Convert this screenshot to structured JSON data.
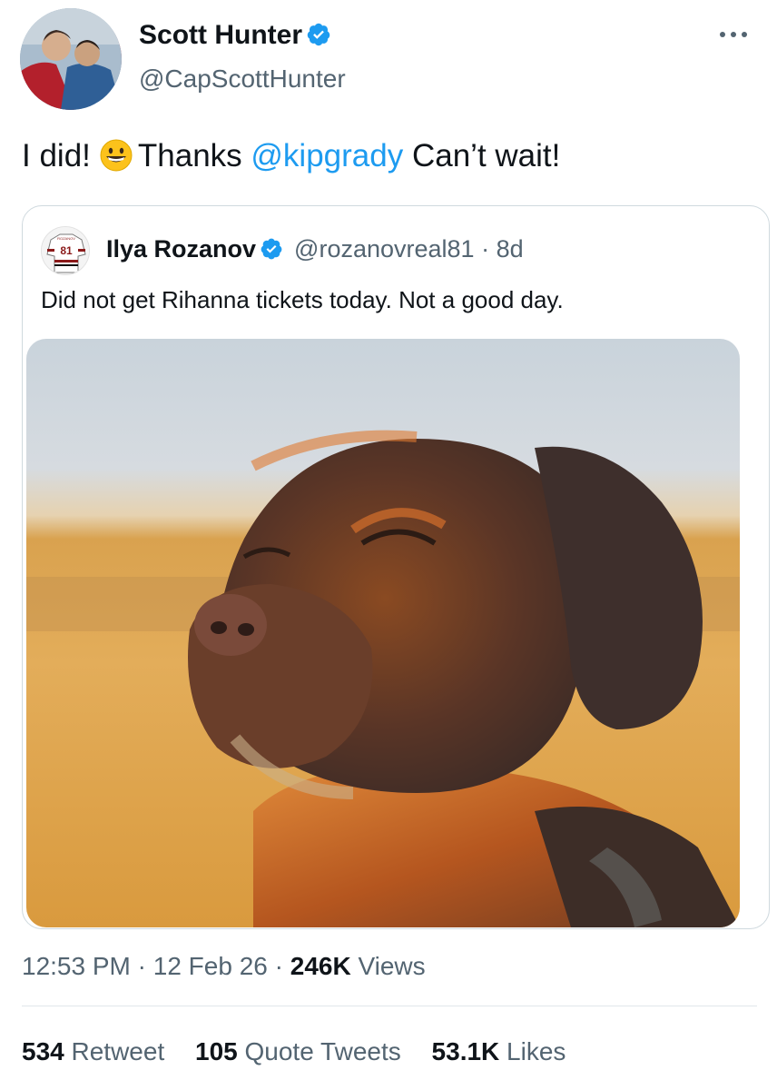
{
  "author": {
    "display_name": "Scott Hunter",
    "handle": "@CapScottHunter",
    "verified": true,
    "avatar_icon": "profile-photo-hockey-players"
  },
  "tweet": {
    "text_part1": "I did!",
    "emoji_icon": "grinning-face-emoji",
    "text_part2": "Thanks",
    "mention": "@kipgrady",
    "text_part3": "Can’t wait!"
  },
  "quoted": {
    "display_name": "Ilya Rozanov",
    "handle": "@rozanovreal81",
    "separator": "·",
    "age": "8d",
    "text": "Did not get Rihanna tickets today. Not a good day.",
    "avatar_icon": "hockey-jersey-81",
    "jersey_number": "81",
    "media_icon": "dog-photo"
  },
  "meta": {
    "time": "12:53 PM",
    "sep1": "·",
    "date": "12 Feb 26",
    "sep2": "·",
    "views_count": "246K",
    "views_label": "Views"
  },
  "stats": {
    "retweets_count": "534",
    "retweets_label": "Retweet",
    "quotes_count": "105",
    "quotes_label": "Quote Tweets",
    "likes_count": "53.1K",
    "likes_label": "Likes"
  },
  "colors": {
    "accent": "#1d9bf0",
    "secondary_text": "#536471",
    "primary_text": "#0f1419"
  }
}
